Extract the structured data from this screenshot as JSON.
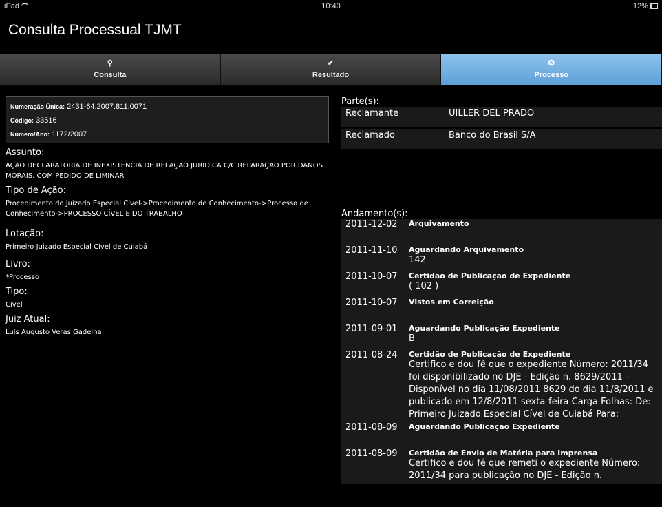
{
  "status": {
    "device": "iPad",
    "time": "10:40",
    "battery": "12%"
  },
  "app": {
    "title": "Consulta Processual TJMT"
  },
  "tabs": [
    {
      "label": "Consulta",
      "icon": "search-icon"
    },
    {
      "label": "Resultado",
      "icon": "check-icon"
    },
    {
      "label": "Processo",
      "icon": "star-icon"
    }
  ],
  "summary": {
    "numeracao_label": "Numeração Única:",
    "numeracao": "2431-64.2007.811.0071",
    "codigo_label": "Código:",
    "codigo": "33516",
    "numero_label": "Número/Ano:",
    "numero": "1172/2007"
  },
  "details": {
    "assunto_h": "Assunto:",
    "assunto": "AÇAO DECLARATORIA DE INEXISTENCIA DE RELAÇAO JURIDICA C/C REPARAÇAO POR DANOS MORAIS, COM PEDIDO DE LIMINAR",
    "tipoacao_h": "Tipo de Ação:",
    "tipoacao": "Procedimento do Juizado Especial Cível->Procedimento de Conhecimento->Processo de Conhecimento->PROCESSO CÍVEL E DO TRABALHO",
    "lotacao_h": "Lotação:",
    "lotacao": "Primeiro Juizado Especial Cível de Cuiabá",
    "livro_h": "Livro:",
    "livro": "*Processo",
    "tipo_h": "Tipo:",
    "tipo": "Cível",
    "juiz_h": "Juiz Atual:",
    "juiz": "Luís Augusto Veras Gadelha"
  },
  "partes": {
    "header": "Parte(s):",
    "items": [
      {
        "role": "Reclamante",
        "name": "UILLER DEL PRADO"
      },
      {
        "role": "Reclamado",
        "name": "Banco do Brasil S/A"
      }
    ]
  },
  "andamentos": {
    "header": "Andamento(s):",
    "items": [
      {
        "date": "2011-12-02",
        "title": "Arquivamento",
        "detail": ""
      },
      {
        "date": "2011-11-10",
        "title": "Aguardando Arquivamento",
        "detail": "142"
      },
      {
        "date": "2011-10-07",
        "title": "Certidão de Publicação de Expediente",
        "detail": "( 102 )"
      },
      {
        "date": "2011-10-07",
        "title": "Vistos em Correição",
        "detail": ""
      },
      {
        "date": "2011-09-01",
        "title": "Aguardando Publicação Expediente",
        "detail": "B"
      },
      {
        "date": "2011-08-24",
        "title": "Certidão de Publicação de Expediente",
        "detail": "Certifico e dou fé que o expediente Número: 2011/34 foi disponibilizado no DJE - Edição n. 8629/2011 - Disponível no dia 11/08/2011 8629 do dia 11/8/2011 e publicado em 12/8/2011 sexta-feira Carga Folhas: De: Primeiro Juizado Especial Cível de Cuiabá Para:"
      },
      {
        "date": "2011-08-09",
        "title": "Aguardando Publicação Expediente",
        "detail": ""
      },
      {
        "date": "2011-08-09",
        "title": "Certidão de Envio de Matéria para Imprensa",
        "detail": "Certifico e dou fé que remeti o expediente Número: 2011/34 para publicação no DJE - Edição n."
      }
    ]
  }
}
